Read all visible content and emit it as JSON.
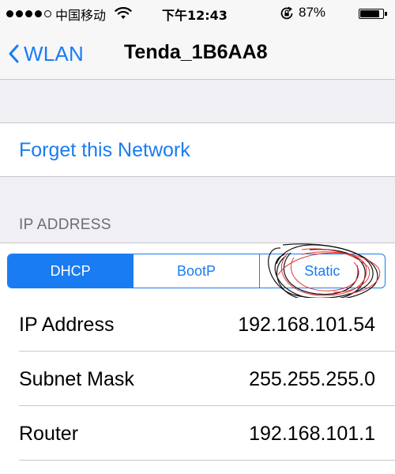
{
  "status_bar": {
    "signal_bars_filled": 4,
    "signal_bars_total": 5,
    "carrier": "中国移动",
    "time": "下午12:43",
    "battery_percent": "87%",
    "battery_level": 0.87
  },
  "nav": {
    "back_label": "WLAN",
    "title": "Tenda_1B6AA8"
  },
  "actions": {
    "forget_label": "Forget this Network"
  },
  "ip_section": {
    "header": "IP ADDRESS",
    "modes": [
      "DHCP",
      "BootP",
      "Static"
    ],
    "selected_mode": "DHCP",
    "rows": [
      {
        "label": "IP Address",
        "value": "192.168.101.54"
      },
      {
        "label": "Subnet Mask",
        "value": "255.255.255.0"
      },
      {
        "label": "Router",
        "value": "192.168.101.1"
      }
    ]
  },
  "colors": {
    "accent": "#1a7cf2",
    "background": "#efeff4",
    "separator": "#c8c7cc",
    "annotation_black": "#111111",
    "annotation_red": "#e0383a"
  }
}
